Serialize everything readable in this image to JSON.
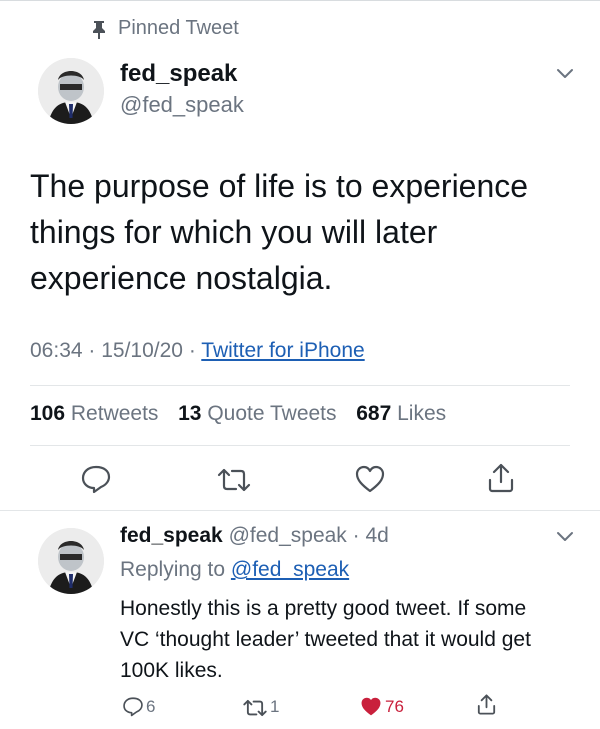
{
  "pinned_label": "Pinned Tweet",
  "tweet": {
    "display_name": "fed_speak",
    "handle": "@fed_speak",
    "text": "The purpose of life is to experience things for which you will later experience nostalgia.",
    "time": "06:34",
    "date": "15/10/20",
    "source": "Twitter for iPhone",
    "stats": {
      "retweets_count": "106",
      "retweets_label": "Retweets",
      "quotes_count": "13",
      "quotes_label": "Quote Tweets",
      "likes_count": "687",
      "likes_label": "Likes"
    }
  },
  "reply": {
    "display_name": "fed_speak",
    "handle": "@fed_speak",
    "age": "4d",
    "replying_to_label": "Replying to",
    "replying_to_handle": "@fed_speak",
    "text": "Honestly this is a pretty good tweet. If some VC ‘thought leader’ tweeted that it would get 100K likes.",
    "reply_count": "6",
    "retweet_count": "1",
    "like_count": "76"
  },
  "colors": {
    "liked": "#c9203c",
    "link": "#1d5fb4",
    "muted": "#6b7480"
  }
}
